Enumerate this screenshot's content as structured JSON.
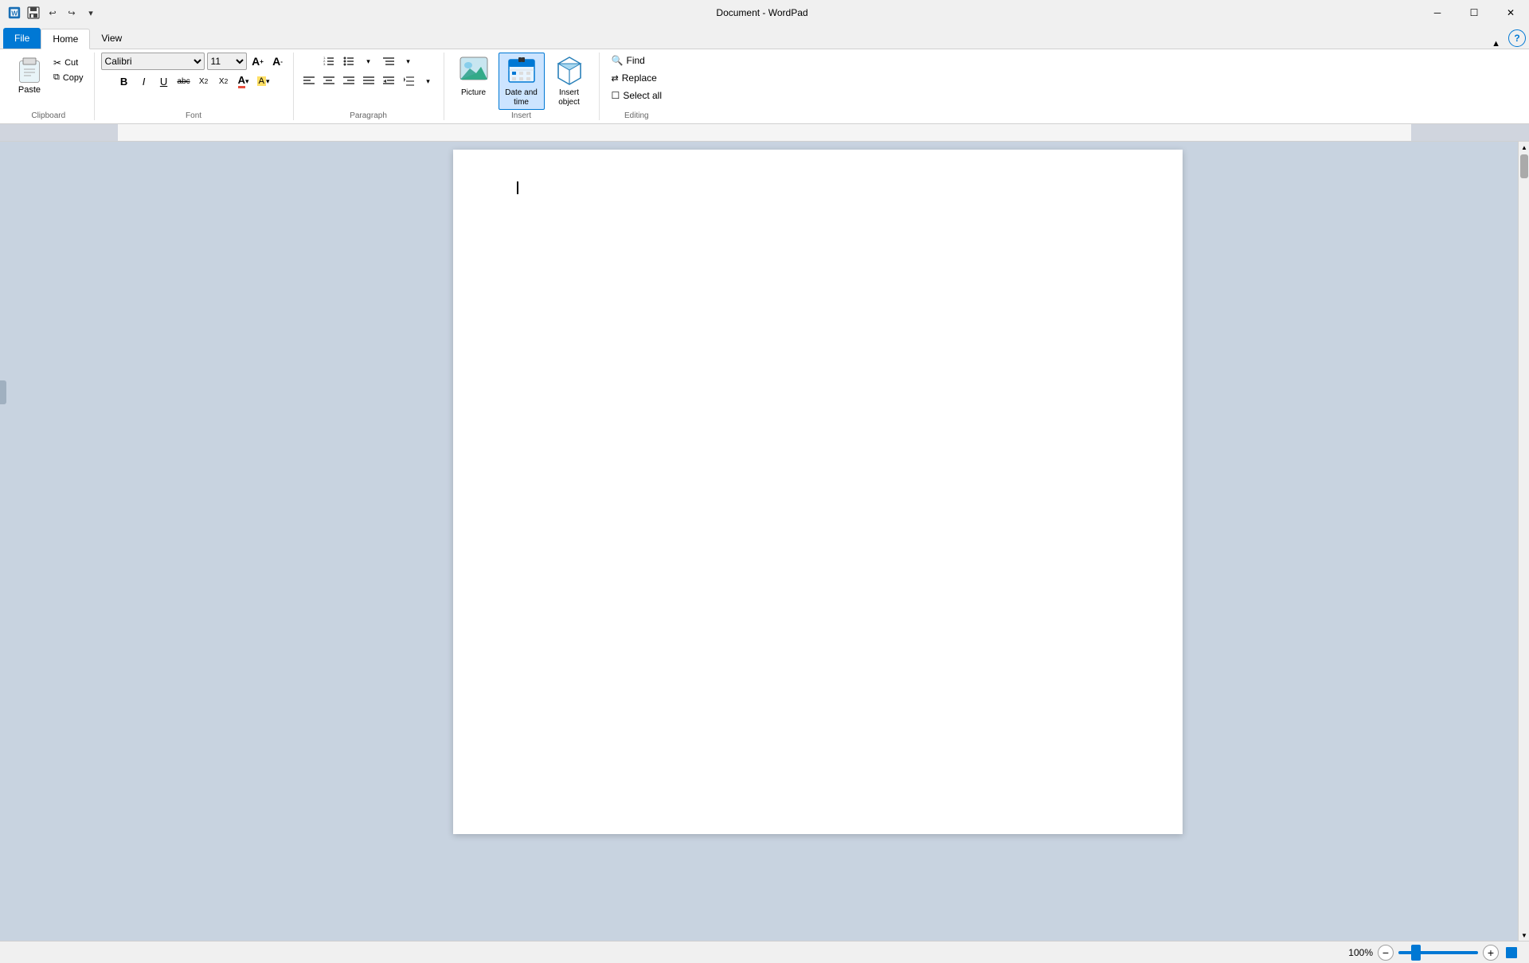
{
  "titleBar": {
    "title": "Document - WordPad",
    "minimizeLabel": "─",
    "maximizeLabel": "☐",
    "closeLabel": "✕"
  },
  "quickAccess": {
    "saveLabel": "💾",
    "undoLabel": "↩",
    "redoLabel": "↪",
    "dropLabel": "▾"
  },
  "tabs": {
    "file": "File",
    "home": "Home",
    "view": "View"
  },
  "clipboard": {
    "groupLabel": "Clipboard",
    "pasteLabel": "Paste",
    "cutLabel": "Cut",
    "copyLabel": "Copy"
  },
  "font": {
    "groupLabel": "Font",
    "fontName": "Calibri",
    "fontSize": "11",
    "boldLabel": "B",
    "italicLabel": "I",
    "underlineLabel": "U",
    "strikeLabel": "abc",
    "subscriptLabel": "X₂",
    "superscriptLabel": "X²",
    "colorLabel": "A",
    "highlightLabel": "A"
  },
  "paragraph": {
    "groupLabel": "Paragraph"
  },
  "insert": {
    "groupLabel": "Insert",
    "pictureLabel": "Picture",
    "dateTimeLabel": "Date and\ntime",
    "insertObjectLabel": "Insert\nobject"
  },
  "editing": {
    "groupLabel": "Editing",
    "findLabel": "Find",
    "replaceLabel": "Replace",
    "selectAllLabel": "Select all"
  },
  "statusBar": {
    "zoomPercent": "100%"
  },
  "ribbon": {
    "collapseLabel": "▲"
  }
}
